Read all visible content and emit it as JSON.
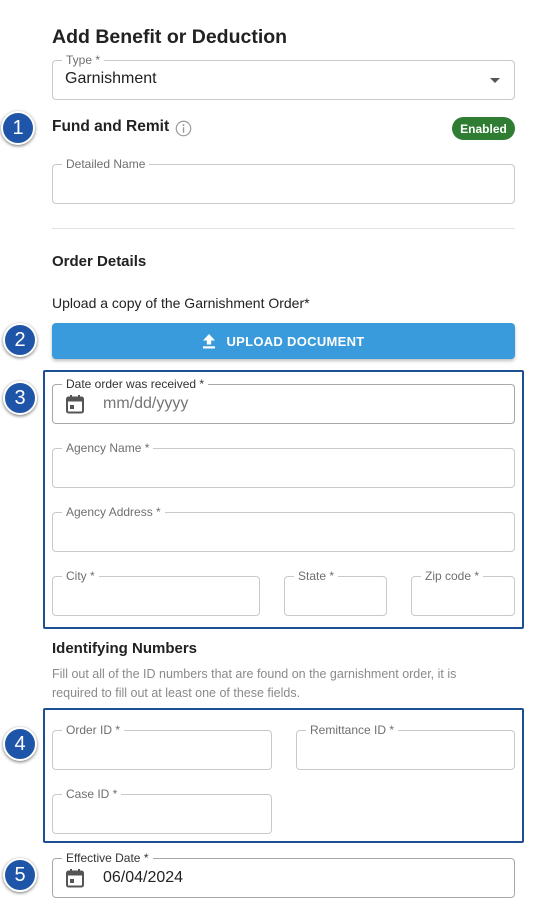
{
  "page": {
    "title": "Add Benefit or Deduction"
  },
  "type_field": {
    "label": "Type *",
    "value": "Garnishment"
  },
  "fund_and_remit": {
    "heading": "Fund and Remit",
    "info_icon": "info-icon",
    "status_badge": "Enabled",
    "badge_color": "#2e7d32"
  },
  "detailed_name": {
    "label": "Detailed Name",
    "value": ""
  },
  "order_details": {
    "heading": "Order Details",
    "upload_prompt": "Upload a copy of the Garnishment Order*",
    "upload_button": "UPLOAD DOCUMENT",
    "upload_icon": "upload-icon",
    "button_color": "#3a9bdc"
  },
  "order_fields": {
    "date_received": {
      "label": "Date order was received *",
      "placeholder": "mm/dd/yyyy",
      "icon": "calendar-icon"
    },
    "agency_name": {
      "label": "Agency Name *",
      "value": ""
    },
    "agency_address": {
      "label": "Agency Address *",
      "value": ""
    },
    "city": {
      "label": "City *",
      "value": ""
    },
    "state": {
      "label": "State *",
      "value": ""
    },
    "zip": {
      "label": "Zip code *",
      "value": ""
    }
  },
  "identifying_numbers": {
    "heading": "Identifying Numbers",
    "help_text": "Fill out all of the ID numbers that are found on the garnishment order, it is required to fill out at least one of these fields.",
    "order_id": {
      "label": "Order ID *",
      "value": ""
    },
    "remittance_id": {
      "label": "Remittance ID *",
      "value": ""
    },
    "case_id": {
      "label": "Case ID *",
      "value": ""
    }
  },
  "effective_date": {
    "label": "Effective Date *",
    "value": "06/04/2024",
    "icon": "calendar-icon"
  },
  "callouts": {
    "color": "#1f55a8",
    "steps": [
      "1",
      "2",
      "3",
      "4",
      "5"
    ]
  }
}
